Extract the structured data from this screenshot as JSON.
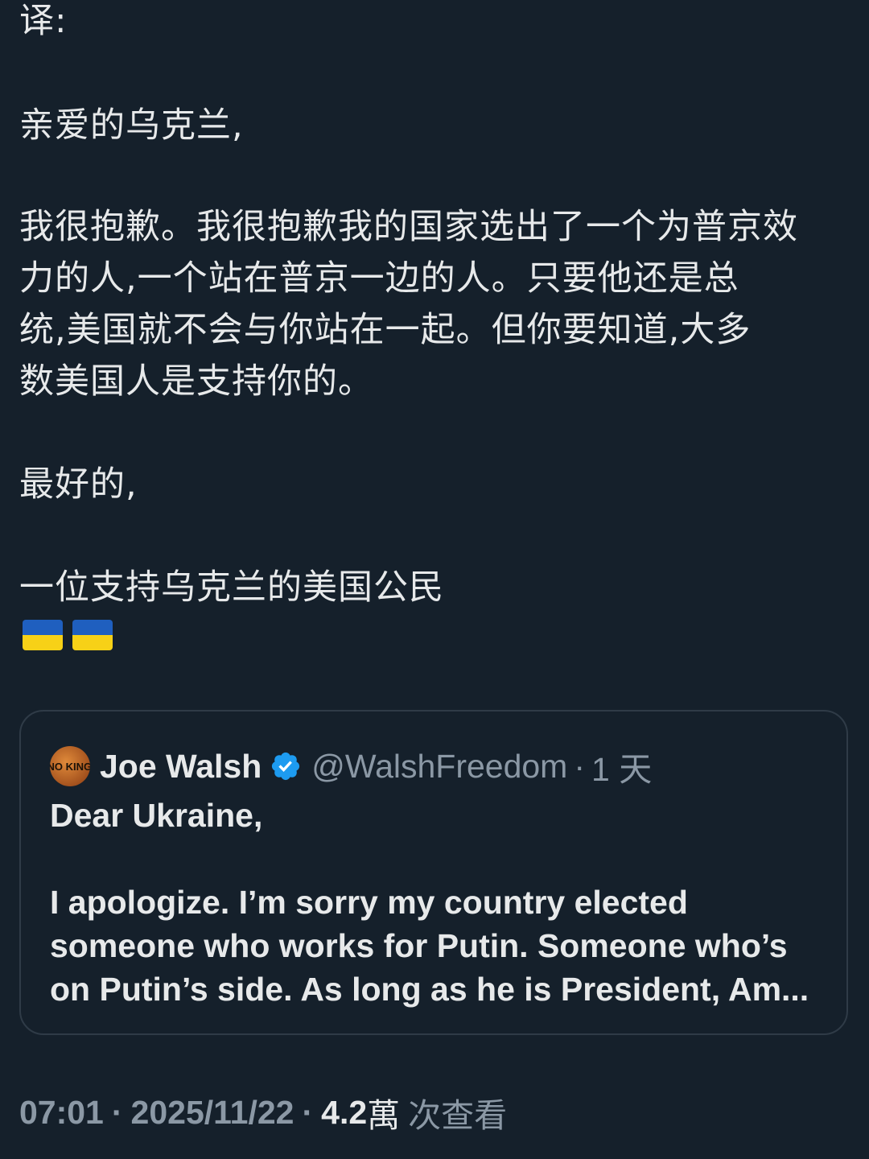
{
  "post": {
    "translation_label": "译:",
    "greeting": "亲爱的乌克兰,",
    "message_lines": [
      "我很抱歉。我很抱歉我的国家选出了一个为普京效",
      "力的人,一个站在普京一边的人。只要他还是总",
      "统,美国就不会与你站在一起。但你要知道,大多",
      "数美国人是支持你的。"
    ],
    "closing": "最好的,",
    "signature": "一位支持乌克兰的美国公民",
    "flags": [
      "ukraine-flag",
      "ukraine-flag"
    ]
  },
  "quoted_post": {
    "avatar_text": "#NO KINGS",
    "author_name": "Joe Walsh",
    "verified": true,
    "verified_color": "#1d9bf0",
    "handle": "@WalshFreedom",
    "separator": "·",
    "time_ago": "1 天",
    "lines": [
      "Dear Ukraine,",
      "",
      "I apologize. I’m sorry my country elected",
      "someone who works for Putin. Someone who’s",
      "on Putin’s side. As long as he is President, Am..."
    ]
  },
  "meta": {
    "time": "07:01",
    "date": "2025/11/22",
    "separator": "·",
    "views_count": "4.2",
    "views_unit": "萬",
    "views_label": "次查看"
  },
  "colors": {
    "background": "#15202b",
    "text_primary": "#e7e9ea",
    "text_secondary": "#8b98a5",
    "border": "#2f3b47"
  }
}
